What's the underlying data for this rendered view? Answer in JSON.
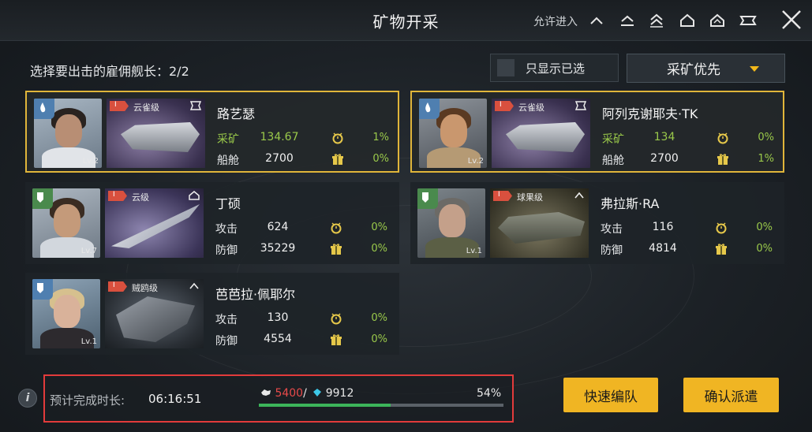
{
  "header": {
    "title": "矿物开采",
    "allow_entry": "允许进入"
  },
  "roster": {
    "label": "选择要出击的雇佣舰长：2/2"
  },
  "filter": {
    "label": "只显示已选",
    "checked": false
  },
  "sort": {
    "label": "采矿优先"
  },
  "captains": [
    {
      "name": "路艺瑟",
      "ship_class": "云雀级",
      "level": "Lv.2",
      "selected": true,
      "stat1_label": "采矿",
      "stat1_value": "134.67",
      "stat1_pct": "1%",
      "stat2_label": "船舱",
      "stat2_value": "2700",
      "stat2_pct": "0%"
    },
    {
      "name": "阿列克谢耶夫·TK",
      "ship_class": "云雀级",
      "level": "Lv.2",
      "selected": true,
      "stat1_label": "采矿",
      "stat1_value": "134",
      "stat1_pct": "0%",
      "stat2_label": "船舱",
      "stat2_value": "2700",
      "stat2_pct": "1%"
    },
    {
      "name": "丁硕",
      "ship_class": "云级",
      "level": "Lv.7",
      "selected": false,
      "stat1_label": "攻击",
      "stat1_value": "624",
      "stat1_pct": "0%",
      "stat2_label": "防御",
      "stat2_value": "35229",
      "stat2_pct": "0%"
    },
    {
      "name": "弗拉斯·RA",
      "ship_class": "球果级",
      "level": "Lv.1",
      "selected": false,
      "stat1_label": "攻击",
      "stat1_value": "116",
      "stat1_pct": "0%",
      "stat2_label": "防御",
      "stat2_value": "4814",
      "stat2_pct": "0%"
    },
    {
      "name": "芭芭拉·佩耶尔",
      "ship_class": "贼鸥级",
      "level": "Lv.1",
      "selected": false,
      "stat1_label": "攻击",
      "stat1_value": "130",
      "stat1_pct": "0%",
      "stat2_label": "防御",
      "stat2_value": "4554",
      "stat2_pct": "0%"
    }
  ],
  "bottom": {
    "eta_label": "预计完成时长:",
    "eta_value": "06:16:51",
    "current": "5400",
    "separator": "/",
    "capacity": "9912",
    "progress_text": "54%",
    "progress": 0.54
  },
  "buttons": {
    "quick_formation": "快速编队",
    "confirm_dispatch": "确认派遣"
  },
  "colors": {
    "accent": "#f0b523",
    "selected_border": "#e0b53a",
    "positive": "#9ac94a",
    "warning": "#e84a4a",
    "progress": "#3cb55a",
    "frame": "#e23b3b"
  }
}
